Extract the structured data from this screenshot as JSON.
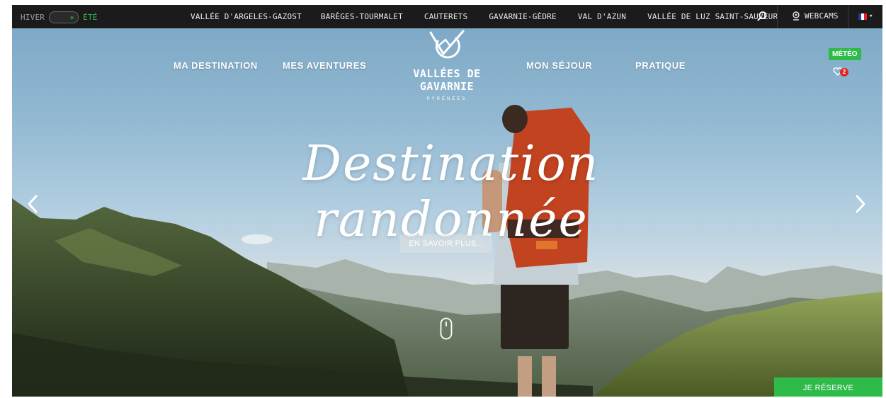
{
  "topbar": {
    "season_left": "HIVER",
    "season_right": "ÉTÉ",
    "valleys": [
      "VALLÉE D'ARGELES-GAZOST",
      "BARÈGES-TOURMALET",
      "CAUTERETS",
      "GAVARNIE-GÈDRE",
      "VAL D'AZUN",
      "VALLÉE DE LUZ SAINT-SAUVEUR"
    ],
    "webcams_label": "WEBCAMS",
    "language_caret": "▾"
  },
  "nav": {
    "left": [
      "MA DESTINATION",
      "MES AVENTURES"
    ],
    "right": [
      "MON SÉJOUR",
      "PRATIQUE"
    ]
  },
  "logo": {
    "name": "VALLÉES DE GAVARNIE",
    "subtitle": "PYRÉNÉES"
  },
  "meteo_label": "MÉTÉO",
  "favorites_count": "2",
  "hero": {
    "headline": "Destination randonnée",
    "cta_label": "EN SAVOIR PLUS..."
  },
  "reserve_label": "JE RÉSERVE",
  "icons": {
    "season": "sun-icon",
    "search": "search-icon",
    "webcam": "webcam-icon",
    "flag": "french-flag-icon",
    "logo": "gavarnie-logo-icon",
    "favorites": "heart-icon",
    "prev": "chevron-left-icon",
    "next": "chevron-right-icon",
    "scroll": "mouse-scroll-icon"
  },
  "colors": {
    "topbar_bg": "#1b1b1b",
    "accent_green": "#2ebb4a",
    "badge_red": "#e02424"
  }
}
